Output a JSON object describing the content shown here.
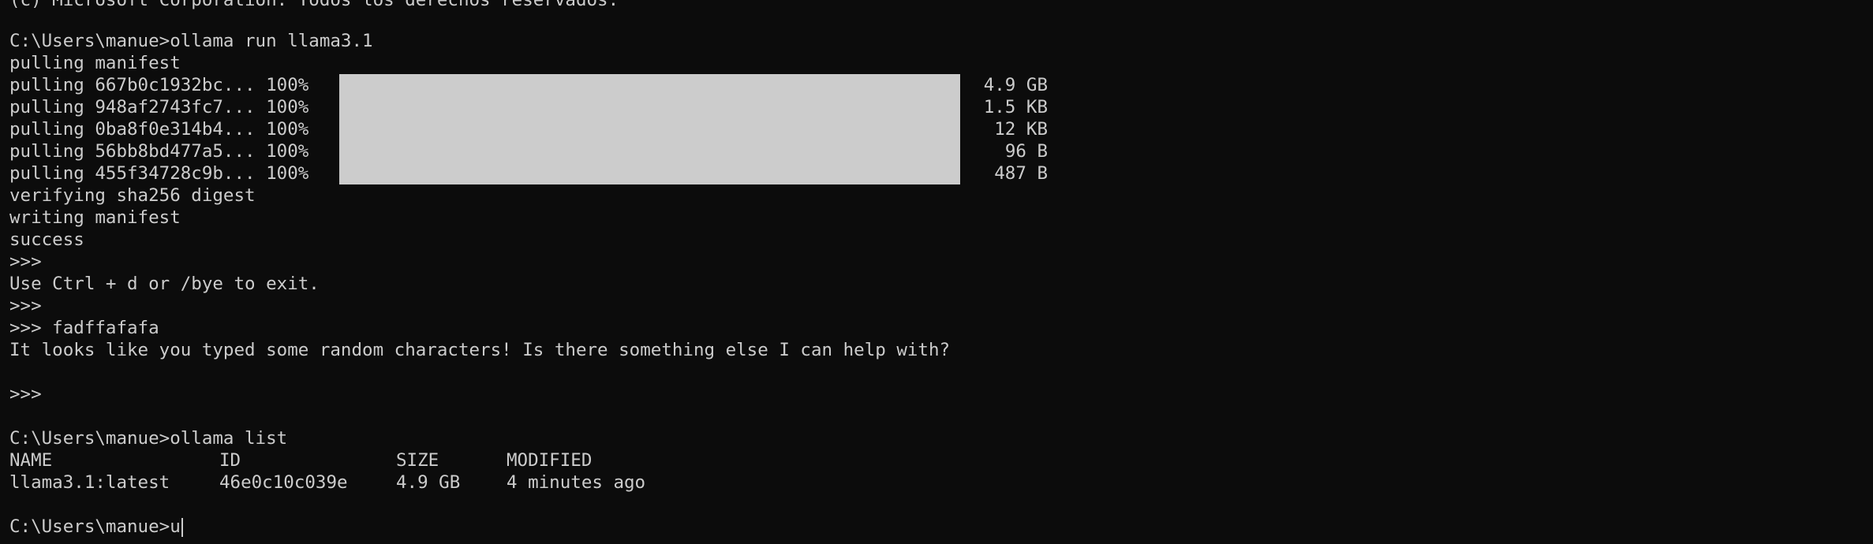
{
  "copyright_line": "(c) Microsoft Corporation. Todos los derechos reservados.",
  "session": {
    "cmd_run": "C:\\Users\\manue>ollama run llama3.1",
    "pulling_manifest": "pulling manifest",
    "layers": [
      {
        "label": "pulling 667b0c1932bc... 100%",
        "size": "4.9 GB",
        "progress": 1.0
      },
      {
        "label": "pulling 948af2743fc7... 100%",
        "size": "1.5 KB",
        "progress": 1.0
      },
      {
        "label": "pulling 0ba8f0e314b4... 100%",
        "size": "12 KB",
        "progress": 1.0
      },
      {
        "label": "pulling 56bb8bd477a5... 100%",
        "size": "96 B",
        "progress": 1.0
      },
      {
        "label": "pulling 455f34728c9b... 100%",
        "size": "487 B",
        "progress": 1.0
      }
    ],
    "verifying": "verifying sha256 digest",
    "writing": "writing manifest",
    "success": "success",
    "prompt1": ">>>",
    "help": "Use Ctrl + d or /bye to exit.",
    "prompt2": ">>>",
    "prompt3": ">>> fadffafafa",
    "response": "It looks like you typed some random characters! Is there something else I can help with?",
    "prompt4": ">>>"
  },
  "list": {
    "cmd": "C:\\Users\\manue>ollama list",
    "headers": {
      "name": "NAME",
      "id": "ID",
      "size": "SIZE",
      "modified": "MODIFIED"
    },
    "rows": [
      {
        "name": "llama3.1:latest",
        "id": "46e0c10c039e",
        "size": "4.9 GB",
        "modified": "4 minutes ago"
      }
    ]
  },
  "current_prompt": {
    "prompt": "C:\\Users\\manue>",
    "input": "u"
  },
  "colors": {
    "background": "#0c0c0c",
    "foreground": "#cccccc",
    "progress_fill": "#cccccc"
  }
}
